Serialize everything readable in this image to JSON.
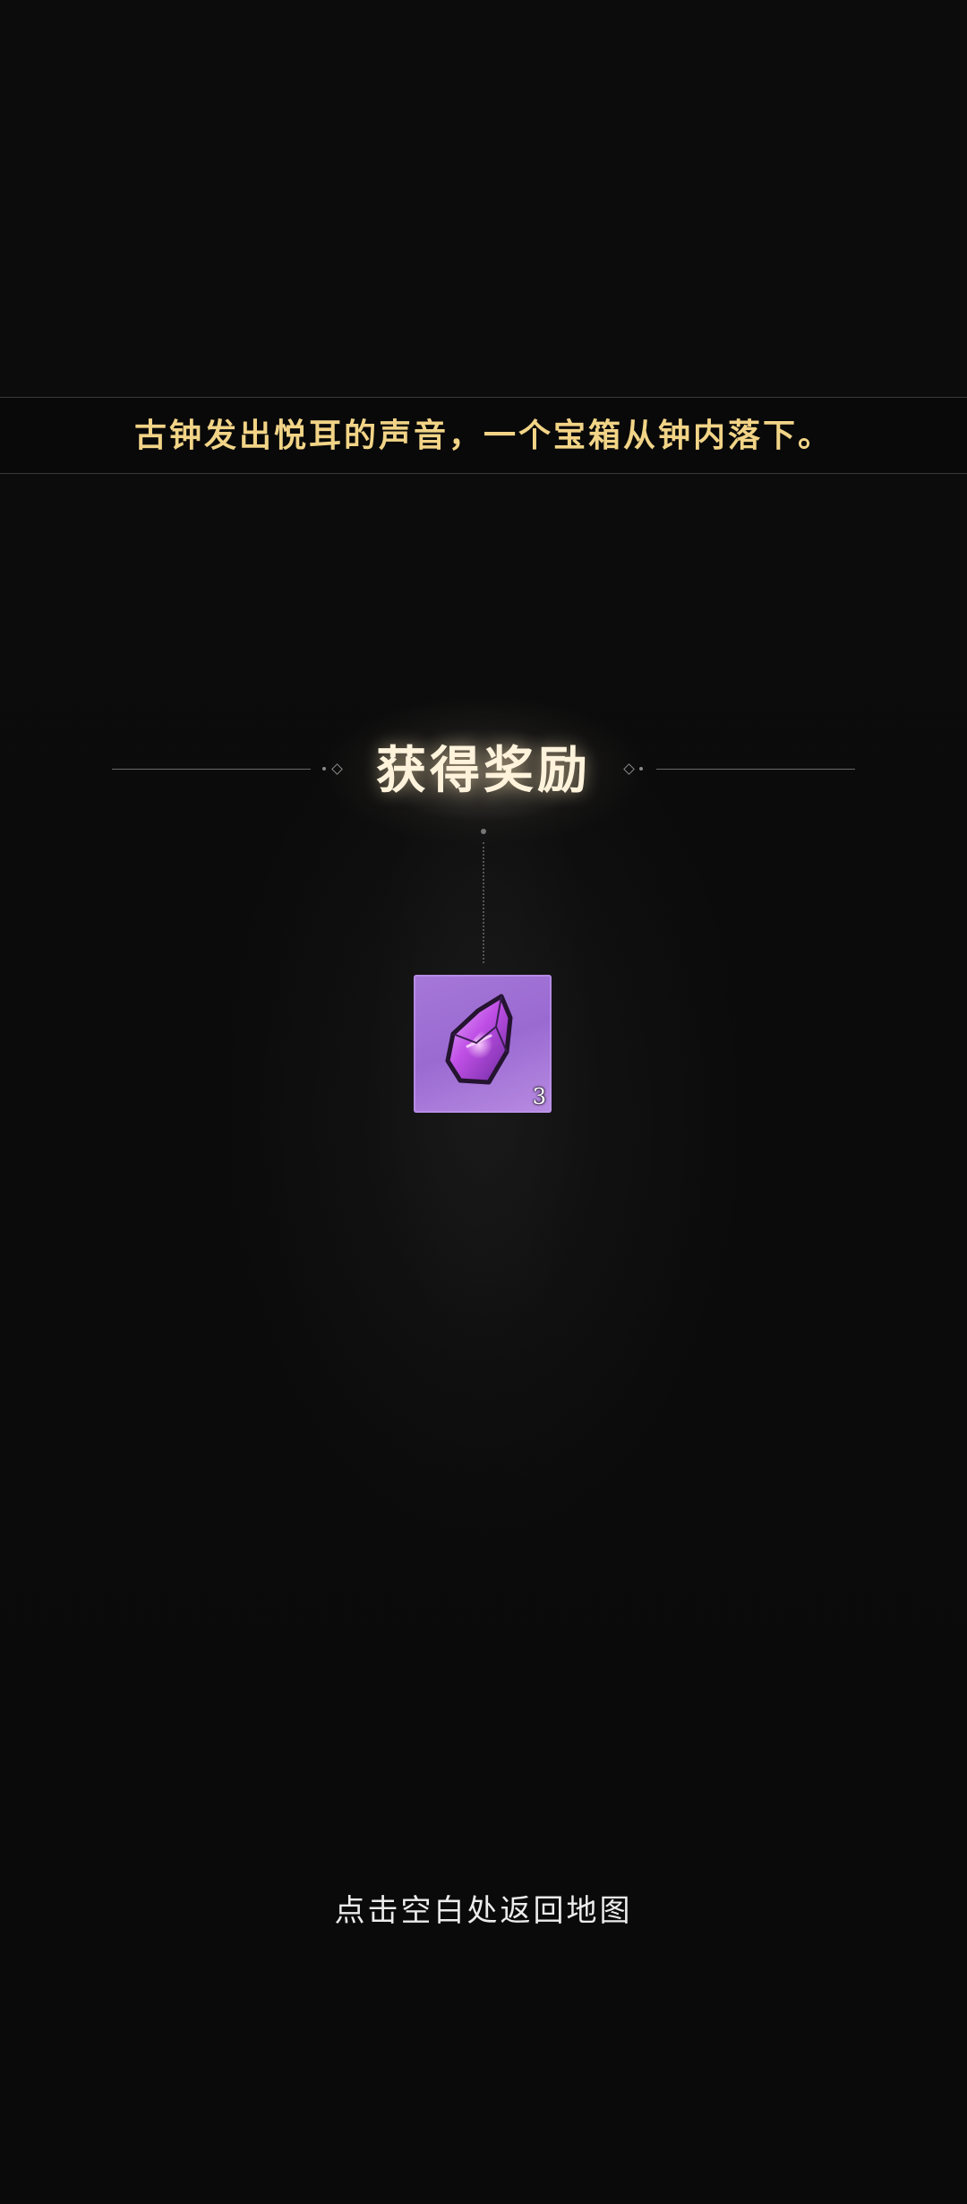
{
  "narration": {
    "text": "古钟发出悦耳的声音，一个宝箱从钟内落下。"
  },
  "reward_panel": {
    "title": "获得奖励",
    "items": [
      {
        "icon": "purple-crystal-icon",
        "count": "3",
        "background_color": "#a678d8"
      }
    ]
  },
  "footer": {
    "hint": "点击空白处返回地图"
  },
  "colors": {
    "narration_text": "#f2d487",
    "title_text": "#fff3dc",
    "background": "#0b0b0b"
  }
}
